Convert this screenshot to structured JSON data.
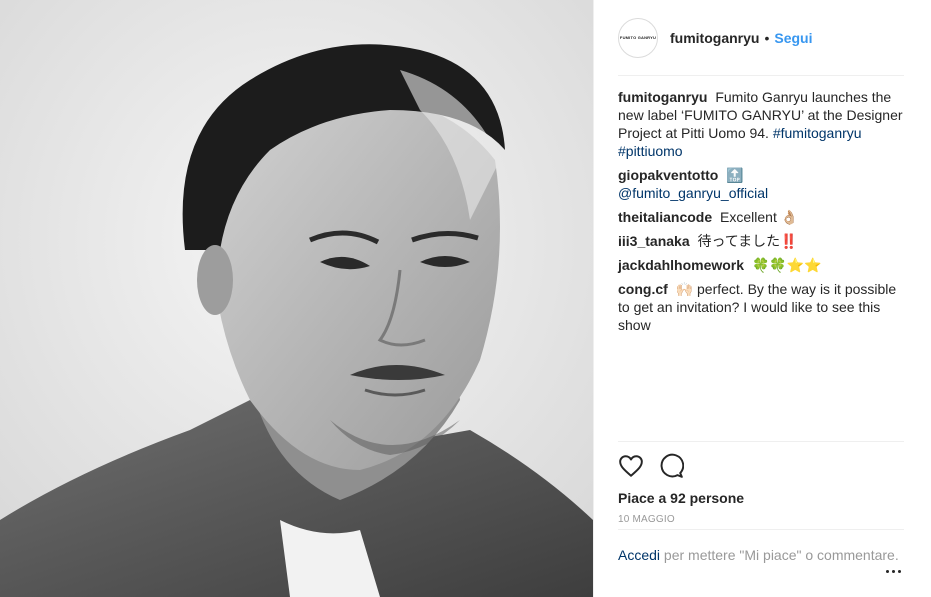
{
  "post": {
    "image_alt": "Black and white portrait of a man",
    "author": {
      "username": "fumitoganryu",
      "avatar_text": "FUMITO GANRYU",
      "separator": "•",
      "follow_label": "Segui"
    },
    "caption": {
      "username": "fumitoganryu",
      "text": "Fumito Ganryu launches the new label ‘FUMITO GANRYU’ at the Designer Project at Pitti Uomo 94.",
      "hashtags": "#fumitoganryu #pittiuomo"
    },
    "comments": [
      {
        "username": "giopakventotto",
        "text": "🔝",
        "mention": "@fumito_ganryu_official"
      },
      {
        "username": "theitaliancode",
        "text": "Excellent 👌🏼"
      },
      {
        "username": "iii3_tanaka",
        "text": "待ってました‼️"
      },
      {
        "username": "jackdahlhomework",
        "text": "🍀🍀⭐⭐"
      },
      {
        "username": "cong.cf",
        "text": "🙌🏻 perfect. By the way is it possible to get an invitation? I would like to see this show"
      }
    ],
    "likes_text": "Piace a 92 persone",
    "date": "10 maggio",
    "footer": {
      "login_label": "Accedi",
      "rest_text": "per mettere \"Mi piace\" o commentare."
    }
  },
  "colors": {
    "accent": "#3897f0",
    "link": "#003569",
    "muted": "#999999",
    "text": "#262626"
  }
}
